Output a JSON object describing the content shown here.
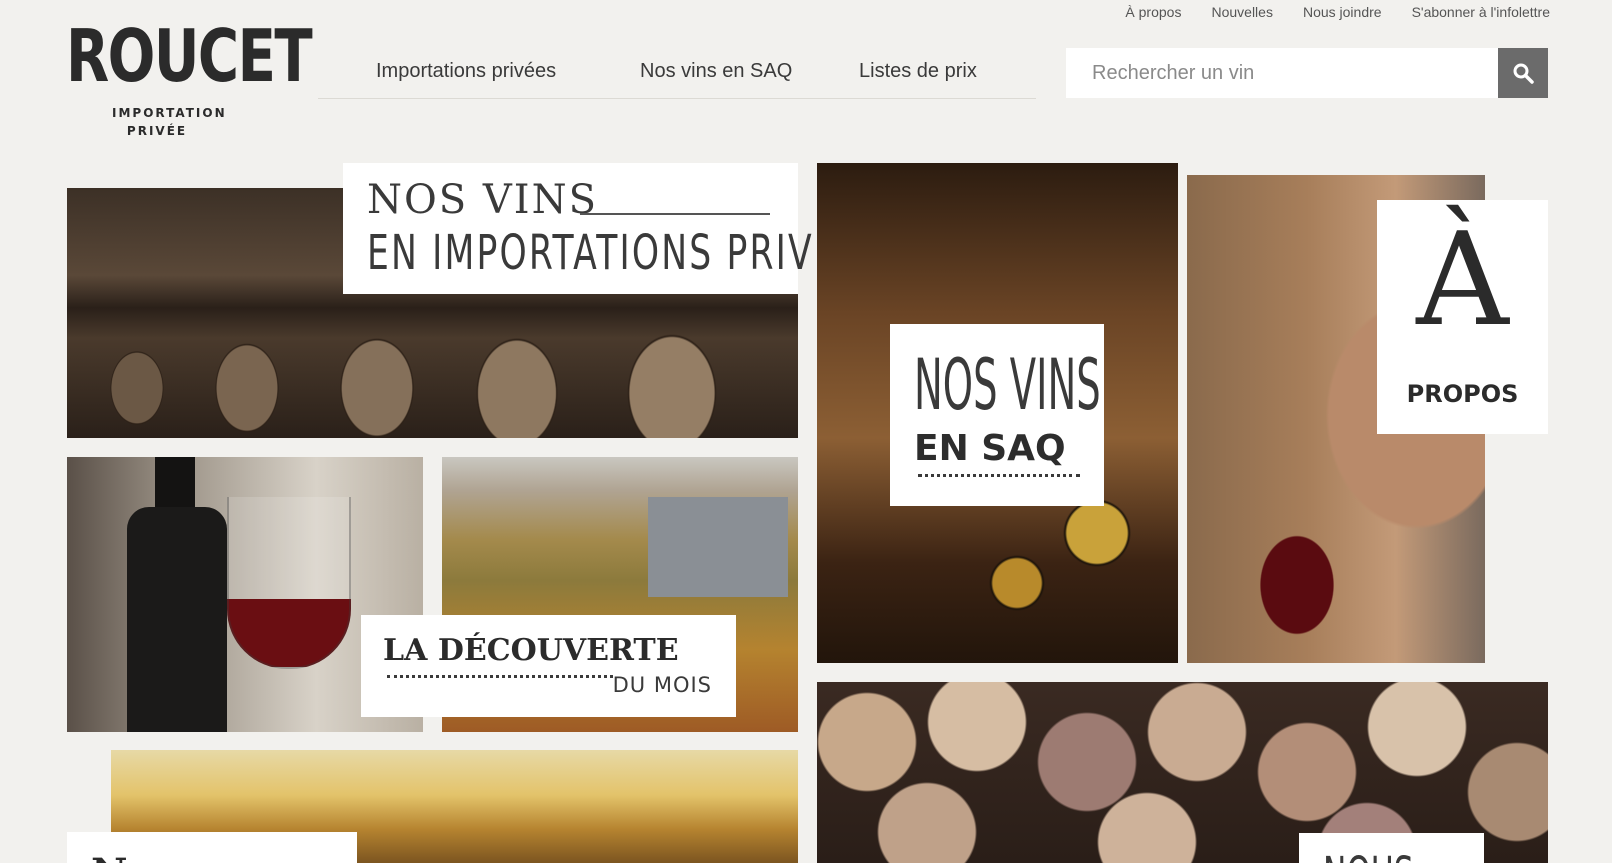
{
  "top_links": [
    "À propos",
    "Nouvelles",
    "Nous joindre",
    "S'abonner à l'infolettre"
  ],
  "logo": {
    "word": "ROUCET",
    "sub_line1": "IMPORTATION",
    "sub_line2": "PRIVÉE"
  },
  "nav": [
    "Importations privées",
    "Nos vins en SAQ",
    "Listes de prix"
  ],
  "search": {
    "placeholder": "Rechercher un vin"
  },
  "tiles": {
    "importations": {
      "line1": "NOS VINS",
      "line2": "EN IMPORTATIONS PRIVÉES"
    },
    "saq": {
      "line1": "NOS VINS",
      "line2": "EN SAQ"
    },
    "apropos": {
      "line1": "À",
      "line2": "PROPOS"
    },
    "decouverte": {
      "line1": "LA DÉCOUVERTE",
      "line2": "DU MOIS"
    },
    "nouvelles": {
      "line1": "N"
    },
    "nous": {
      "line1": "NOUS"
    }
  }
}
